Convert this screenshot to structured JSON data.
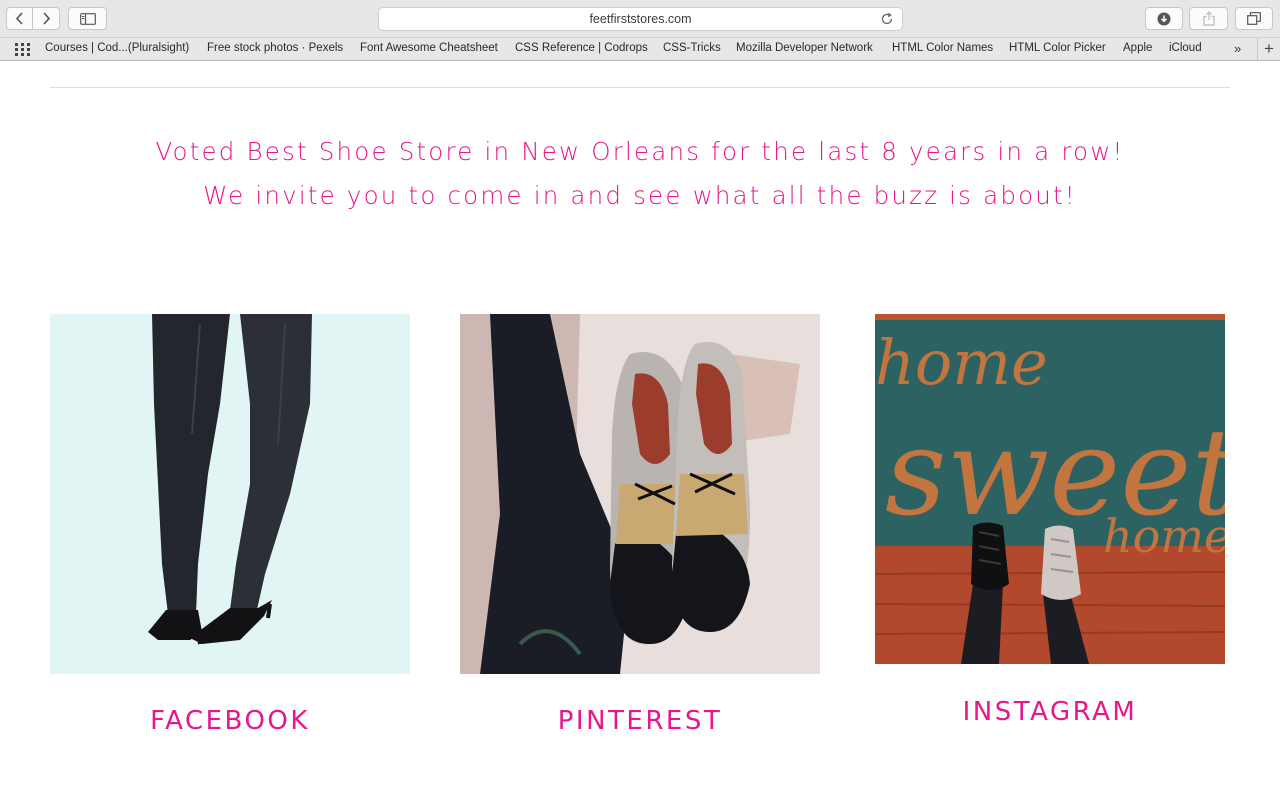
{
  "browser": {
    "url": "feetfirststores.com",
    "bookmarks": [
      "Courses | Cod...(Pluralsight)",
      "Free stock photos · Pexels",
      "Font Awesome Cheatsheet",
      "CSS Reference | Codrops",
      "CSS-Tricks",
      "Mozilla Developer Network",
      "HTML Color Names",
      "HTML Color Picker",
      "Apple",
      "iCloud"
    ],
    "more_label": "»",
    "add_label": "+"
  },
  "page": {
    "tagline_1": "Voted Best Shoe Store in New Orleans for the last 8 years in a row!",
    "tagline_2": "We invite you to come in and see what all the buzz is about!",
    "accent_color": "#e8168b",
    "cards": [
      {
        "label": "FACEBOOK",
        "image": "black-pumps-on-mint-background"
      },
      {
        "label": "PINTEREST",
        "image": "glitter-oxford-shoes"
      },
      {
        "label": "INSTAGRAM",
        "image": "home-sweet-home-doormat"
      }
    ],
    "doormat_text": [
      "home",
      "sweet",
      "home"
    ]
  }
}
